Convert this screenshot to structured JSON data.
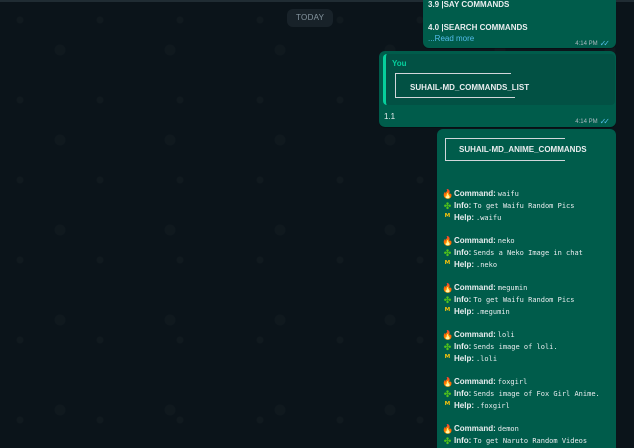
{
  "date_chip": "TODAY",
  "message1": {
    "lines": [
      "3.9 |SAY COMMANDS",
      "4.0 |SEARCH COMMANDS"
    ],
    "read_more": "...Read more",
    "time": "4:14 PM"
  },
  "message2": {
    "quote_author": "You",
    "quote_title": "SUHAIL-MD_COMMANDS_LIST",
    "reply_text": "1.1",
    "time": "4:14 PM"
  },
  "message3": {
    "title": "SUHAIL-MD_ANIME_COMMANDS",
    "labels": {
      "command": "Command:",
      "info": "Info:",
      "help": "Help:"
    },
    "commands": [
      {
        "command": "waifu",
        "info": "To get Waifu Random Pics",
        "help": ".waifu"
      },
      {
        "command": "neko",
        "info": "Sends a Neko Image in chat",
        "help": ".neko"
      },
      {
        "command": "megumin",
        "info": "To get Waifu Random Pics",
        "help": ".megumin"
      },
      {
        "command": "loli",
        "info": "Sends image of loli.",
        "help": ".loli"
      },
      {
        "command": "foxgirl",
        "info": "Sends image of Fox Girl Anime.",
        "help": ".foxgirl"
      },
      {
        "command": "demon",
        "info": "To get Naruto Random Videos",
        "help": ""
      }
    ]
  },
  "icons": {
    "command": "fire-icon",
    "info": "puzzle-icon",
    "help": "m-icon",
    "read_status": "double-check-icon"
  },
  "colors": {
    "outgoing_bubble": "#005c4b",
    "background": "#0b141a",
    "accent": "#06cf9c",
    "link": "#53bdeb"
  }
}
